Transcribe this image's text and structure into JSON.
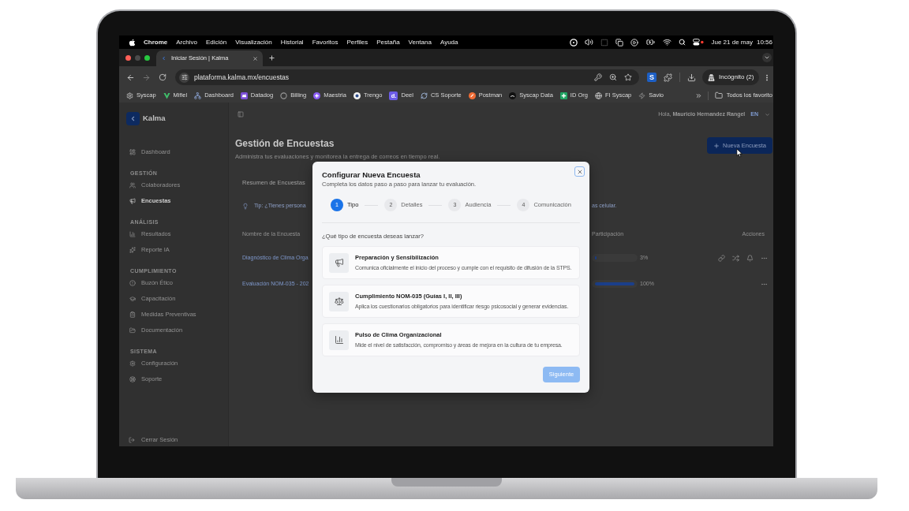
{
  "menu_bar": {
    "app": "Chrome",
    "menus": [
      "Archivo",
      "Edición",
      "Visualización",
      "Historial",
      "Favoritos",
      "Perfiles",
      "Pestaña",
      "Ventana",
      "Ayuda"
    ],
    "date": "Jue 21 de may",
    "time": "10:56"
  },
  "browser": {
    "tabs": [
      {
        "title": "Iniciar Sesión | Kalma",
        "selected": true
      }
    ],
    "url": "plataforma.kalma.mx/encuestas",
    "extension": "S",
    "profile": "Incógnito (2)",
    "bookmarks": [
      {
        "label": "Syscap"
      },
      {
        "label": "Mifiel"
      },
      {
        "label": "Dashboard"
      },
      {
        "label": "Datadog"
      },
      {
        "label": "Billing"
      },
      {
        "label": "Maestria"
      },
      {
        "label": "Trengo"
      },
      {
        "label": "Deel",
        "icon_text": "d."
      },
      {
        "label": "CS Soporte"
      },
      {
        "label": "Postman"
      },
      {
        "label": "Syscap Data"
      },
      {
        "label": "ID Org"
      },
      {
        "label": "FI Syscap"
      },
      {
        "label": "Savio"
      }
    ],
    "all_bookmarks": "Todos los favorito"
  },
  "sidebar": {
    "brand": "Kalma",
    "sections": [
      {
        "items": [
          {
            "label": "Dashboard",
            "selected": false
          }
        ]
      },
      {
        "title": "GESTIÓN",
        "items": [
          {
            "label": "Colaboradores",
            "selected": false
          },
          {
            "label": "Encuestas",
            "selected": true
          }
        ]
      },
      {
        "title": "ANÁLISIS",
        "items": [
          {
            "label": "Resultados",
            "selected": false
          },
          {
            "label": "Reporte IA",
            "selected": false
          }
        ]
      },
      {
        "title": "CUMPLIMIENTO",
        "items": [
          {
            "label": "Buzón Ético",
            "selected": false
          },
          {
            "label": "Capacitación",
            "selected": false
          },
          {
            "label": "Medidas Preventivas",
            "selected": false
          },
          {
            "label": "Documentación",
            "selected": false
          }
        ]
      },
      {
        "title": "SISTEMA",
        "items": [
          {
            "label": "Configuración",
            "selected": false
          },
          {
            "label": "Soporte",
            "selected": false
          }
        ]
      }
    ],
    "logout": "Cerrar Sesión"
  },
  "header": {
    "greeting": "Hola, **Mauricio Hernandez Rangel**",
    "language": "EN"
  },
  "page": {
    "title": "Gestión de Encuestas",
    "subtitle": "Administra tus evaluaciones y monitorea la entrega de correos en tiempo real.",
    "new_button": "Nueva Encuesta",
    "summary_title": "Resumen de Encuestas",
    "tip": {
      "left": "Tip: ¿Tienes persona",
      "right": "as celular."
    },
    "table": {
      "columns": [
        "Nombre de la Encuesta",
        "Participación",
        "Acciones"
      ],
      "rows": [
        {
          "name": "Diagnóstico de Clima Orga",
          "kind": "in_progress",
          "level": 0.03,
          "participation": "3%"
        },
        {
          "name": "Evaluación NOM-035 - 202",
          "kind": "completed",
          "level": 1,
          "participation": "100%"
        }
      ]
    }
  },
  "modal": {
    "title": "Configurar Nueva Encuesta",
    "subtitle": "Completa los datos paso a paso para lanzar tu evaluación.",
    "steps": [
      {
        "number": "1",
        "label": "Tipo",
        "selected": true
      },
      {
        "number": "2",
        "label": "Detalles",
        "selected": false
      },
      {
        "number": "3",
        "label": "Audiencia",
        "selected": false
      },
      {
        "number": "4",
        "label": "Comunicación",
        "selected": false
      }
    ],
    "question": "¿Qué tipo de encuesta deseas lanzar?",
    "options": [
      {
        "title": "Preparación y Sensibilización",
        "description": "Comunica oficialmente el inicio del proceso y cumple con el requisito de difusión de la STPS.",
        "selected": false
      },
      {
        "title": "Cumplimiento NOM-035 (Guías I, II, III)",
        "description": "Aplica los cuestionarios obligatorios para identificar riesgo psicosocial y generar evidencias.",
        "selected": false
      },
      {
        "title": "Pulso de Clima Organizacional",
        "description": "Mide el nivel de satisfacción, compromiso y áreas de mejora en la cultura de tu empresa.",
        "selected": false
      }
    ],
    "next_button": {
      "label": "Siguiente",
      "disabled": true
    }
  }
}
